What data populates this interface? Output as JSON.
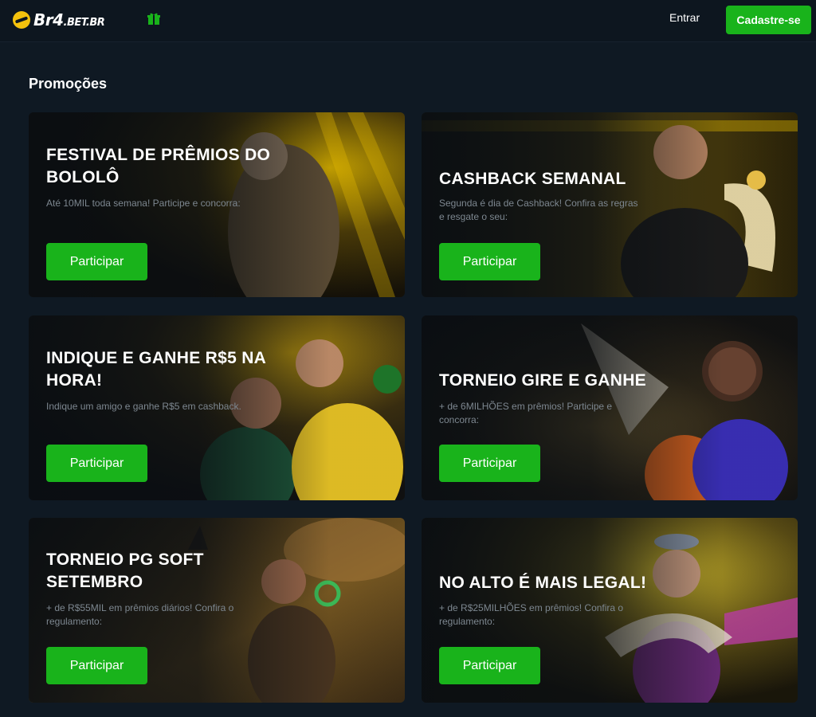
{
  "header": {
    "logo_main": "Br4",
    "logo_suffix": ".BET.BR",
    "login_label": "Entrar",
    "signup_label": "Cadastre-se"
  },
  "page": {
    "title": "Promoções"
  },
  "promotions": [
    {
      "title": "FESTIVAL DE PRÊMIOS DO BOLOLÔ",
      "description": "Até 10MIL toda semana! Participe e concorra:",
      "button": "Participar"
    },
    {
      "title": "CASHBACK SEMANAL",
      "description": "Segunda é dia de Cashback! Confira as regras e resgate o seu:",
      "button": "Participar"
    },
    {
      "title": "INDIQUE E GANHE R$5 NA HORA!",
      "description": "Indique um amigo e ganhe R$5 em cashback.",
      "button": "Participar"
    },
    {
      "title": "TORNEIO GIRE E GANHE",
      "description": "+ de 6MILHÕES em prêmios! Participe e concorra:",
      "button": "Participar"
    },
    {
      "title": "TORNEIO PG SOFT SETEMBRO",
      "description": "+ de R$55MIL em prêmios diários! Confira o regulamento:",
      "button": "Participar"
    },
    {
      "title": "NO ALTO É MAIS LEGAL!",
      "description": "+ de R$25MILHÕES em prêmios! Confira o regulamento:",
      "button": "Participar"
    }
  ],
  "colors": {
    "accent": "#19b31b",
    "background": "#0f1923",
    "header": "#0d161f"
  }
}
